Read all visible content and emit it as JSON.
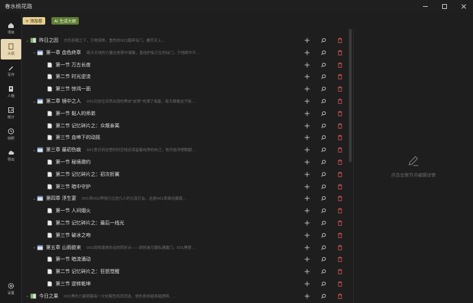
{
  "app": {
    "title": "春水桃花路"
  },
  "sidebar": {
    "items": [
      {
        "id": "project",
        "label": "项目",
        "icon": "home-icon"
      },
      {
        "id": "outline",
        "label": "大纲",
        "icon": "document-icon"
      },
      {
        "id": "write",
        "label": "写作",
        "icon": "pen-icon"
      },
      {
        "id": "characters",
        "label": "人物",
        "icon": "person-card-icon"
      },
      {
        "id": "stats",
        "label": "统计",
        "icon": "chart-icon"
      },
      {
        "id": "snapshot",
        "label": "快照",
        "icon": "clock-icon"
      },
      {
        "id": "export",
        "label": "导出",
        "icon": "cloud-upload-icon"
      }
    ],
    "settings_label": "设置"
  },
  "toolbar": {
    "add_label": "+ 添加卷",
    "ai_label": "AI 生成大纲"
  },
  "tree": [
    {
      "level": 0,
      "type": "volume",
      "name": "昨日之因",
      "desc": "白色吞噬之下，万物凋零。重伤的001踏碎仙门，屠尽天上…"
    },
    {
      "level": 1,
      "type": "chapter",
      "name": "第一章 血色终章",
      "desc": "毁灭天地的力量在他掌中凝聚，曾经护佑万生的仙门，于他眼中不过…"
    },
    {
      "level": 2,
      "type": "section",
      "name": "第一节 万古长夜"
    },
    {
      "level": 2,
      "type": "section",
      "name": "第二节 时光逆流"
    },
    {
      "level": 2,
      "type": "section",
      "name": "第三节 惊鸿一面"
    },
    {
      "level": 1,
      "type": "chapter",
      "name": "第二章 镜中之人",
      "desc": "001对这位突然出现的黑衣\"前辈\"充满了戒备，每天都看这子接…"
    },
    {
      "level": 2,
      "type": "section",
      "name": "第一节 黏人的师弟"
    },
    {
      "level": 2,
      "type": "section",
      "name": "第二节 记忆碎片之：众叛亲离"
    },
    {
      "level": 2,
      "type": "section",
      "name": "第三节 血啼下的动摇"
    },
    {
      "level": 1,
      "type": "chapter",
      "name": "第三章 最初伤痕",
      "desc": "001意识到这里的时空线还保留着纯净的自己，他开始浮想联翩…"
    },
    {
      "level": 2,
      "type": "section",
      "name": "第一节 秘境邀约"
    },
    {
      "level": 2,
      "type": "section",
      "name": "第二节 记忆碎片之：初次折翼"
    },
    {
      "level": 2,
      "type": "section",
      "name": "第三节 暗中守护"
    },
    {
      "level": 1,
      "type": "chapter",
      "name": "第四章 浮生宴",
      "desc": "001带001界强行过进凡人的元宵灯会，这是001表面经藏痛…"
    },
    {
      "level": 2,
      "type": "section",
      "name": "第一节 人间烟火"
    },
    {
      "level": 2,
      "type": "section",
      "name": "第二节 记忆碎片之：最后一线光"
    },
    {
      "level": 2,
      "type": "section",
      "name": "第三节 破冰之吻"
    },
    {
      "level": 1,
      "type": "chapter",
      "name": "第五章 山雨欲来",
      "desc": "001即将遭遇命运的转折点——即将被污蔑私通魔门。001黑想…"
    },
    {
      "level": 2,
      "type": "section",
      "name": "第一节 暗流涌动"
    },
    {
      "level": 2,
      "type": "section",
      "name": "第二节 记忆碎片之：狂怒觉醒"
    },
    {
      "level": 2,
      "type": "section",
      "name": "第三节 逆转乾坤"
    },
    {
      "level": 0,
      "type": "volume",
      "name": "今日之果",
      "desc": "001黑的力量随着每一次化解危机而消逝，他的身体越来越透明。…"
    }
  ],
  "detail": {
    "hint": "点击左侧节点编辑详情"
  },
  "colors": {
    "accent": "#e8d9b4",
    "ai_button": "#5f7d33",
    "add_button": "#e6cf91",
    "delete": "#b94a4a"
  }
}
